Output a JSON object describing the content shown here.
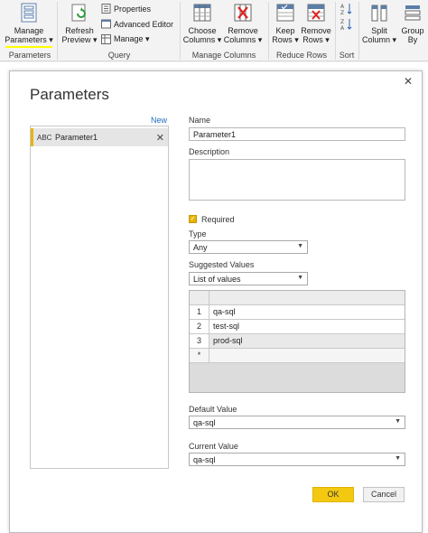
{
  "ribbon": {
    "manage_params": {
      "line1": "Manage",
      "line2": "Parameters ▾"
    },
    "refresh_preview": {
      "line1": "Refresh",
      "line2": "Preview ▾"
    },
    "properties": "Properties",
    "advanced_editor": "Advanced Editor",
    "manage": "Manage ▾",
    "choose_columns": {
      "line1": "Choose",
      "line2": "Columns ▾"
    },
    "remove_columns": {
      "line1": "Remove",
      "line2": "Columns ▾"
    },
    "keep_rows": {
      "line1": "Keep",
      "line2": "Rows ▾"
    },
    "remove_rows": {
      "line1": "Remove",
      "line2": "Rows ▾"
    },
    "split_column": {
      "line1": "Split",
      "line2": "Column ▾"
    },
    "group_by": {
      "line1": "Group",
      "line2": "By"
    },
    "groups": {
      "parameters": "Parameters",
      "query": "Query",
      "manage_columns": "Manage Columns",
      "reduce_rows": "Reduce Rows",
      "sort": "Sort"
    }
  },
  "dialog": {
    "title": "Parameters",
    "close_glyph": "✕",
    "new_link": "New",
    "list": [
      {
        "type_glyph": "ABC",
        "name": "Parameter1",
        "remove_glyph": "✕"
      }
    ],
    "name_label": "Name",
    "name_value": "Parameter1",
    "description_label": "Description",
    "description_value": "",
    "required_label": "Required",
    "required_checked": true,
    "type_label": "Type",
    "type_value": "Any",
    "suggested_label": "Suggested Values",
    "suggested_value": "List of values",
    "values_grid": {
      "rows": [
        {
          "n": "1",
          "v": "qa-sql"
        },
        {
          "n": "2",
          "v": "test-sql"
        },
        {
          "n": "3",
          "v": "prod-sql"
        }
      ],
      "new_row_marker": "*"
    },
    "default_label": "Default Value",
    "default_value": "qa-sql",
    "current_label": "Current Value",
    "current_value": "qa-sql",
    "ok_label": "OK",
    "cancel_label": "Cancel"
  },
  "colors": {
    "accent": "#f2c811",
    "link": "#1f6fbf",
    "highlight_underline": "#ffff00"
  }
}
